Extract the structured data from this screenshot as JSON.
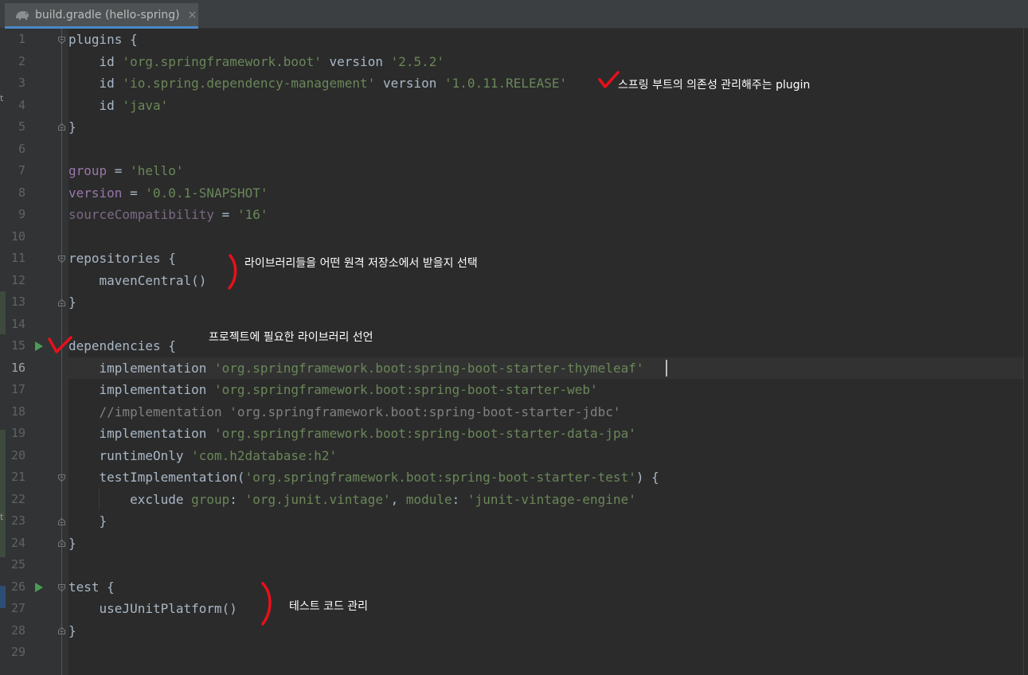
{
  "tab": {
    "title": "build.gradle (hello-spring)",
    "close": "×",
    "icon": "gradle-elephant-icon"
  },
  "edge_chars": [
    "t",
    "t"
  ],
  "current_line": 16,
  "lines": [
    {
      "n": "1"
    },
    {
      "n": "2"
    },
    {
      "n": "3"
    },
    {
      "n": "4"
    },
    {
      "n": "5"
    },
    {
      "n": "6"
    },
    {
      "n": "7"
    },
    {
      "n": "8"
    },
    {
      "n": "9"
    },
    {
      "n": "10"
    },
    {
      "n": "11"
    },
    {
      "n": "12"
    },
    {
      "n": "13"
    },
    {
      "n": "14"
    },
    {
      "n": "15"
    },
    {
      "n": "16"
    },
    {
      "n": "17"
    },
    {
      "n": "18"
    },
    {
      "n": "19"
    },
    {
      "n": "20"
    },
    {
      "n": "21"
    },
    {
      "n": "22"
    },
    {
      "n": "23"
    },
    {
      "n": "24"
    },
    {
      "n": "25"
    },
    {
      "n": "26"
    },
    {
      "n": "27"
    },
    {
      "n": "28"
    },
    {
      "n": "29"
    }
  ],
  "code": {
    "l1": "plugins {",
    "l2_a": "    id ",
    "l2_b": "'org.springframework.boot'",
    "l2_c": " version ",
    "l2_d": "'2.5.2'",
    "l3_a": "    id ",
    "l3_b": "'io.spring.dependency-management'",
    "l3_c": " version ",
    "l3_d": "'1.0.11.RELEASE'",
    "l4_a": "    id ",
    "l4_b": "'java'",
    "l5": "}",
    "l7_a": "group",
    "l7_b": " = ",
    "l7_c": "'hello'",
    "l8_a": "version",
    "l8_b": " = ",
    "l8_c": "'0.0.1-SNAPSHOT'",
    "l9_a": "sourceCompatibility",
    "l9_b": " = ",
    "l9_c": "'16'",
    "l11": "repositories {",
    "l12": "    mavenCentral()",
    "l13": "}",
    "l15": "dependencies {",
    "l16_a": "    implementation ",
    "l16_b": "'org.springframework.boot:spring-boot-starter-thymeleaf'",
    "l17_a": "    implementation ",
    "l17_b": "'org.springframework.boot:spring-boot-starter-web'",
    "l18": "    //implementation 'org.springframework.boot:spring-boot-starter-jdbc'",
    "l19_a": "    implementation ",
    "l19_b": "'org.springframework.boot:spring-boot-starter-data-jpa'",
    "l20_a": "    runtimeOnly ",
    "l20_b": "'com.h2database:h2'",
    "l21_a": "    testImplementation(",
    "l21_b": "'org.springframework.boot:spring-boot-starter-test'",
    "l21_c": ") {",
    "l22_a": "        exclude ",
    "l22_b": "group",
    "l22_c": ": ",
    "l22_d": "'org.junit.vintage'",
    "l22_e": ", ",
    "l22_f": "module",
    "l22_g": ": ",
    "l22_h": "'junit-vintage-engine'",
    "l23": "    }",
    "l24": "}",
    "l26": "test {",
    "l27": "    useJUnitPlatform()",
    "l28": "}"
  },
  "annotations": {
    "plugin_note": "스프링 부트의 의존성 관리해주는 plugin",
    "repo_note": "라이브러리들을 어떤 원격 저장소에서 받을지 선택",
    "deps_note": "프로젝트에 필요한 라이브러리 선언",
    "test_note": "테스트 코드 관리"
  },
  "colors": {
    "background": "#2b2b2b",
    "gutter": "#313335",
    "string": "#6a8759",
    "property": "#9876aa",
    "comment": "#808080",
    "text": "#a9b7c6",
    "run_icon": "#499c54",
    "annotation_mark": "#e8101a"
  }
}
